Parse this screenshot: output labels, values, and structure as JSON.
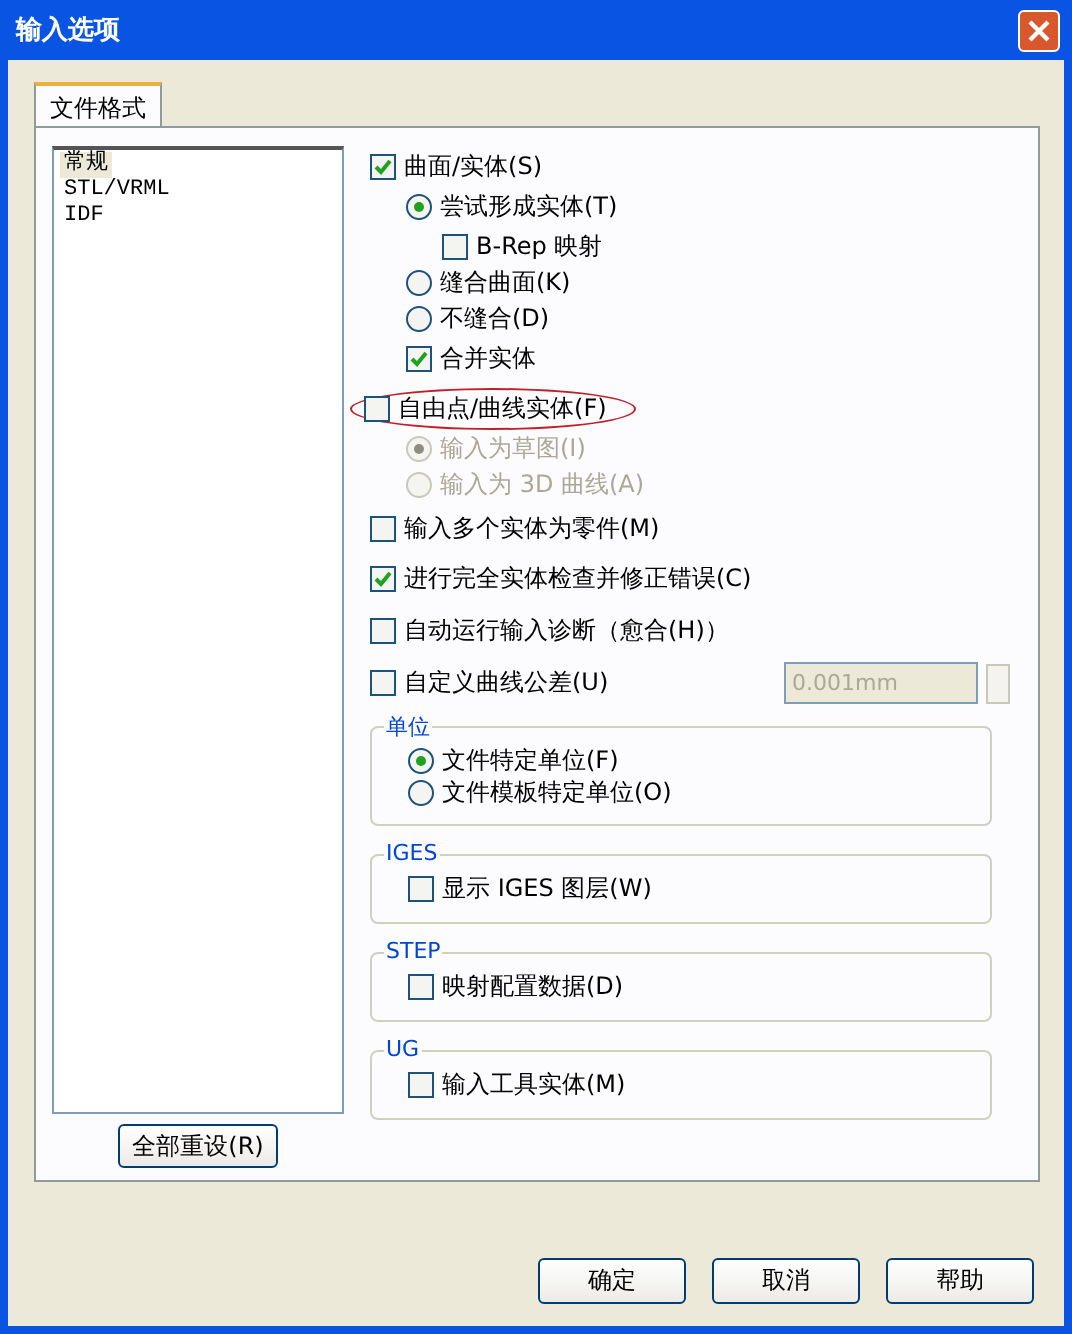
{
  "window": {
    "title": "输入选项"
  },
  "tabs": [
    {
      "label": "文件格式",
      "selected": true
    }
  ],
  "formats": [
    {
      "label": "常规",
      "selected": true
    },
    {
      "label": "STL/VRML",
      "selected": false
    },
    {
      "label": "IDF",
      "selected": false
    }
  ],
  "options": [
    {
      "kind": "checkbox",
      "label": "曲面/实体(S)",
      "checked": true,
      "disabled": false,
      "children": [
        {
          "kind": "radio",
          "label": "尝试形成实体(T)",
          "selected": true,
          "disabled": false,
          "children": [
            {
              "kind": "checkbox",
              "label": "B-Rep 映射",
              "checked": false,
              "disabled": false
            }
          ]
        },
        {
          "kind": "radio",
          "label": "缝合曲面(K)",
          "selected": false,
          "disabled": false
        },
        {
          "kind": "radio",
          "label": "不缝合(D)",
          "selected": false,
          "disabled": false
        },
        {
          "kind": "checkbox",
          "label": "合并实体",
          "checked": true,
          "disabled": false
        }
      ]
    },
    {
      "kind": "checkbox",
      "label": "自由点/曲线实体(F)",
      "checked": false,
      "disabled": false,
      "circled": true,
      "children": [
        {
          "kind": "radio",
          "label": "输入为草图(I)",
          "selected": true,
          "disabled": true
        },
        {
          "kind": "radio",
          "label": "输入为 3D 曲线(A)",
          "selected": false,
          "disabled": true
        }
      ]
    },
    {
      "kind": "checkbox",
      "label": "输入多个实体为零件(M)",
      "checked": false,
      "disabled": false
    },
    {
      "kind": "checkbox",
      "label": "进行完全实体检查并修正错误(C)",
      "checked": true,
      "disabled": false
    },
    {
      "kind": "checkbox",
      "label": "自动运行输入诊断（愈合(H)）",
      "checked": false,
      "disabled": false
    },
    {
      "kind": "checkbox",
      "label": "自定义曲线公差(U)",
      "checked": false,
      "disabled": false,
      "field": {
        "value": "0.001mm",
        "disabled": true
      }
    }
  ],
  "groups": [
    {
      "title": "单位",
      "items": [
        {
          "kind": "radio",
          "label": "文件特定单位(F)",
          "selected": true,
          "disabled": false
        },
        {
          "kind": "radio",
          "label": "文件模板特定单位(O)",
          "selected": false,
          "disabled": false
        }
      ]
    },
    {
      "title": "IGES",
      "items": [
        {
          "kind": "checkbox",
          "label": "显示 IGES 图层(W)",
          "checked": false,
          "disabled": false
        }
      ]
    },
    {
      "title": "STEP",
      "items": [
        {
          "kind": "checkbox",
          "label": "映射配置数据(D)",
          "checked": false,
          "disabled": false
        }
      ]
    },
    {
      "title": "UG",
      "items": [
        {
          "kind": "checkbox",
          "label": "输入工具实体(M)",
          "checked": false,
          "disabled": false
        }
      ]
    }
  ],
  "reset_button": "全部重设(R)",
  "buttons": [
    "确定",
    "取消",
    "帮助"
  ]
}
